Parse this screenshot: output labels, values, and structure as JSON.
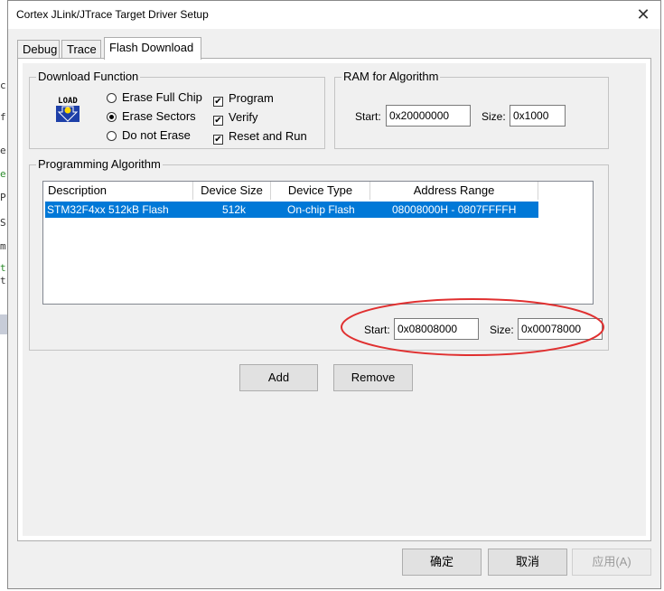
{
  "window": {
    "title": "Cortex JLink/JTrace Target Driver Setup",
    "close_glyph": "✕"
  },
  "background_fragments": [
    "c",
    "f",
    "e",
    "er",
    "P",
    "S",
    "m",
    "t",
    "t"
  ],
  "tabs": [
    {
      "label": "Debug"
    },
    {
      "label": "Trace"
    },
    {
      "label": "Flash Download"
    }
  ],
  "download_function": {
    "legend": "Download Function",
    "load_icon_text": "LOAD",
    "radios": [
      {
        "label": "Erase Full Chip",
        "checked": false
      },
      {
        "label": "Erase Sectors",
        "checked": true
      },
      {
        "label": "Do not Erase",
        "checked": false
      }
    ],
    "checks": [
      {
        "label": "Program",
        "checked": true
      },
      {
        "label": "Verify",
        "checked": true
      },
      {
        "label": "Reset and Run",
        "checked": true
      }
    ]
  },
  "ram_for_algorithm": {
    "legend": "RAM for Algorithm",
    "start_label": "Start:",
    "start_value": "0x20000000",
    "size_label": "Size:",
    "size_value": "0x1000"
  },
  "programming_algorithm": {
    "legend": "Programming Algorithm",
    "columns": [
      "Description",
      "Device Size",
      "Device Type",
      "Address Range"
    ],
    "rows": [
      {
        "description": "STM32F4xx 512kB Flash",
        "device_size": "512k",
        "device_type": "On-chip Flash",
        "address_range": "08008000H - 0807FFFFH"
      }
    ],
    "start_label": "Start:",
    "start_value": "0x08008000",
    "size_label": "Size:",
    "size_value": "0x00078000"
  },
  "buttons": {
    "add": "Add",
    "remove": "Remove",
    "ok": "确定",
    "cancel": "取消",
    "apply": "应用(A)"
  },
  "colors": {
    "selection": "#0078d7",
    "highlight_ellipse": "#e03030"
  }
}
